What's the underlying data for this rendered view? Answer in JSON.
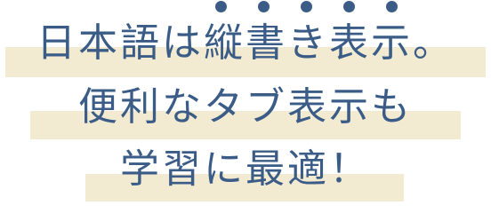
{
  "colors": {
    "text": "#3a5c86",
    "highlight": "#f3ead2",
    "dots": "#3a5c86",
    "background": "#ffffff"
  },
  "emphasis_dots": 5,
  "lines": [
    "日本語は縦書き表示。",
    "便利なタブ表示も",
    "学習に最適！"
  ]
}
